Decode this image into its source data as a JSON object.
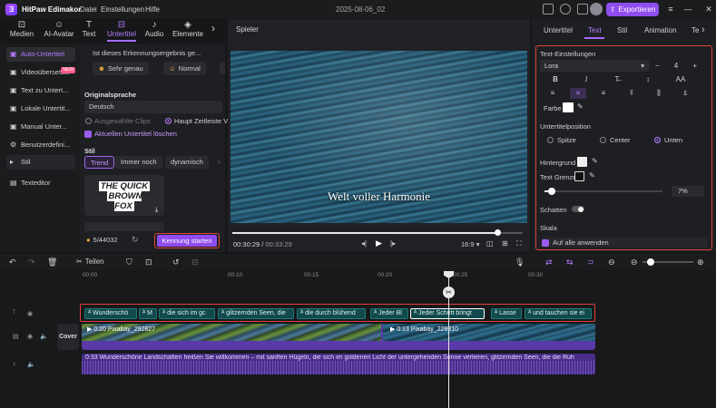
{
  "app": {
    "title": "HitPaw Edimakor",
    "date_title": "2025-08-06_02",
    "export_label": "Exportieren"
  },
  "menu": [
    "Datei",
    "Einstellungen",
    "Hilfe"
  ],
  "toolbar": [
    {
      "label": "Medien",
      "icon": "media-icon"
    },
    {
      "label": "AI-Avatar",
      "icon": "avatar-icon"
    },
    {
      "label": "Text",
      "icon": "text-icon"
    },
    {
      "label": "Untertitel",
      "icon": "subtitle-icon"
    },
    {
      "label": "Audio",
      "icon": "audio-icon"
    },
    {
      "label": "Elemente",
      "icon": "elements-icon"
    }
  ],
  "leftnav": [
    {
      "label": "Auto-Untertitel",
      "active": true
    },
    {
      "label": "Videoübersetzer",
      "badge": "NEW"
    },
    {
      "label": "Text zu Untert..."
    },
    {
      "label": "Lokale Untertit..."
    },
    {
      "label": "Manual Unter..."
    },
    {
      "label": "Benutzerdefini..."
    },
    {
      "label": "Stil"
    },
    {
      "label": "Texteditor"
    }
  ],
  "leftpanel": {
    "question": "Ist dieses Erkennungsergebnis ge...",
    "rating_good": "Sehr genau",
    "rating_normal": "Normal",
    "orig_lang_title": "Originalsprache",
    "orig_lang_value": "Deutsch",
    "opt_selected_clips": "Ausgewählte Clips",
    "opt_main_timeline": "Haupt Zeitleiste V",
    "delete_current": "Aktuellen Untertitel löschen",
    "style_title": "Stil",
    "styles": [
      "Trend",
      "Immer noch",
      "dynamisch"
    ],
    "preview_text_line1": "THE QUICK",
    "preview_text_line2": "BROWN FOX",
    "credits": "5/44032",
    "start_button": "Kennung starten"
  },
  "player": {
    "title": "Spieler",
    "caption": "Welt voller Harmonie",
    "current_time": "00:30:29",
    "total_time": "00:33:29",
    "aspect": "16:9",
    "progress": 0.91
  },
  "rightpanel": {
    "tabs": [
      "Untertitel",
      "Text",
      "Stil",
      "Animation",
      "Te"
    ],
    "active_tab": "Text",
    "text_settings_title": "Text-Einstellungen",
    "font": "Lora",
    "font_size": "4",
    "format_row1": [
      "B",
      "I",
      "T̶",
      "↕",
      "AA"
    ],
    "color_label": "Farbe",
    "position_title": "Untertitelposition",
    "positions": [
      "Spitze",
      "Center",
      "Unten"
    ],
    "selected_position": "Unten",
    "bg_label": "Hintergrund",
    "border_label": "Text Grenze",
    "opacity_value": "7%",
    "shadow_label": "Schatten",
    "scale_title": "Skala",
    "apply_all": "Auf alle anwenden"
  },
  "timeline": {
    "split_label": "Teilen",
    "ruler": [
      "00:00",
      "00:10",
      "00:15",
      "00:20",
      "00:25",
      "00:30"
    ],
    "cover_label": "Cover",
    "subtitle_clips": [
      "Wunderschö",
      "M",
      "die sich im gc",
      "glitzernden Seen, die",
      "die durch blühend",
      "Jeder Bl",
      "Jeder Schritt bringt",
      "Lasse",
      "und tauchen sie ei"
    ],
    "video_clip1": "0:20 Pixabay_292827",
    "video_clip2": "0:13 Pixabay_228810",
    "audio_text": "0:33 Wunderschöne Landschaften heißen Sie willkommen – mit sanften Hügeln, die sich im goldenen Licht der untergehenden Sonne verlieren, glitzernden Seen, die die Ruh"
  }
}
